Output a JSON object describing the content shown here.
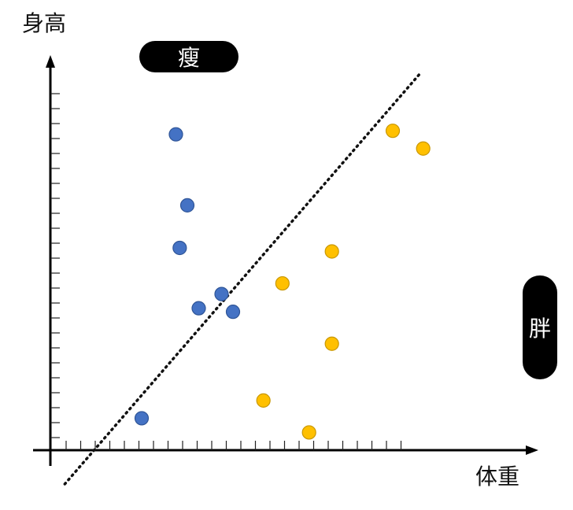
{
  "chart_data": {
    "type": "scatter",
    "xlabel": "体重",
    "ylabel": "身高",
    "annotations": {
      "thin": "瘦",
      "fat": "胖"
    },
    "series": [
      {
        "color": "#4472C4",
        "points": [
          [
            3.3,
            8.9
          ],
          [
            3.6,
            6.9
          ],
          [
            3.4,
            5.7
          ],
          [
            3.9,
            4.0
          ],
          [
            4.5,
            4.4
          ],
          [
            4.8,
            3.9
          ],
          [
            2.4,
            0.9
          ]
        ]
      },
      {
        "color": "#FFC000",
        "points": [
          [
            9.0,
            9.0
          ],
          [
            9.8,
            8.5
          ],
          [
            7.4,
            5.6
          ],
          [
            6.1,
            4.7
          ],
          [
            7.4,
            3.0
          ],
          [
            5.6,
            1.4
          ],
          [
            6.8,
            0.5
          ]
        ]
      }
    ],
    "boundary": {
      "style": "dotted",
      "color": "#111111",
      "from": [
        1.0,
        0.0
      ],
      "to": [
        9.6,
        10.0
      ]
    },
    "xlim": [
      0,
      12
    ],
    "ylim": [
      0,
      11
    ],
    "grid": false
  }
}
